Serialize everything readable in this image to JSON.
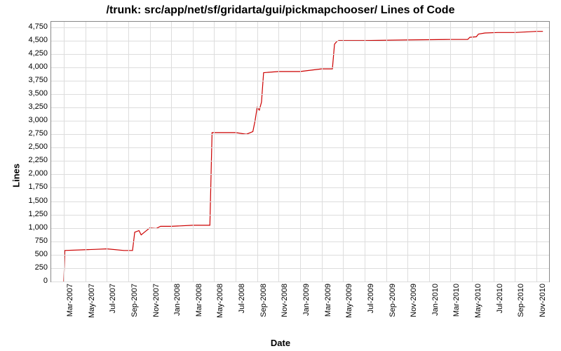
{
  "chart_data": {
    "type": "line",
    "title": "/trunk: src/app/net/sf/gridarta/gui/pickmapchooser/ Lines of Code",
    "xlabel": "Date",
    "ylabel": "Lines",
    "ylim": [
      0,
      4850
    ],
    "yticks": [
      0,
      250,
      500,
      750,
      1000,
      1250,
      1500,
      1750,
      2000,
      2250,
      2500,
      2750,
      3000,
      3250,
      3500,
      3750,
      4000,
      4250,
      4500,
      4750
    ],
    "x_categories": [
      "Mar-2007",
      "May-2007",
      "Jul-2007",
      "Sep-2007",
      "Nov-2007",
      "Jan-2008",
      "Mar-2008",
      "May-2008",
      "Jul-2008",
      "Sep-2008",
      "Nov-2008",
      "Jan-2009",
      "Mar-2009",
      "May-2009",
      "Jul-2009",
      "Sep-2009",
      "Nov-2009",
      "Jan-2010",
      "Mar-2010",
      "May-2010",
      "Jul-2010",
      "Sep-2010",
      "Nov-2010"
    ],
    "series": [
      {
        "name": "Lines of Code",
        "color": "#cc0000",
        "points": [
          {
            "xi": 0.0,
            "y": 0
          },
          {
            "xi": 0.05,
            "y": 580
          },
          {
            "xi": 1.5,
            "y": 600
          },
          {
            "xi": 2.0,
            "y": 610
          },
          {
            "xi": 2.8,
            "y": 580
          },
          {
            "xi": 3.2,
            "y": 580
          },
          {
            "xi": 3.3,
            "y": 920
          },
          {
            "xi": 3.5,
            "y": 950
          },
          {
            "xi": 3.6,
            "y": 870
          },
          {
            "xi": 4.0,
            "y": 1000
          },
          {
            "xi": 4.3,
            "y": 990
          },
          {
            "xi": 4.5,
            "y": 1030
          },
          {
            "xi": 5.0,
            "y": 1030
          },
          {
            "xi": 6.0,
            "y": 1050
          },
          {
            "xi": 6.8,
            "y": 1050
          },
          {
            "xi": 6.9,
            "y": 2780
          },
          {
            "xi": 8.0,
            "y": 2780
          },
          {
            "xi": 8.5,
            "y": 2750
          },
          {
            "xi": 8.8,
            "y": 2800
          },
          {
            "xi": 8.9,
            "y": 3000
          },
          {
            "xi": 9.0,
            "y": 3250
          },
          {
            "xi": 9.1,
            "y": 3200
          },
          {
            "xi": 9.2,
            "y": 3350
          },
          {
            "xi": 9.3,
            "y": 3900
          },
          {
            "xi": 10.0,
            "y": 3920
          },
          {
            "xi": 11.0,
            "y": 3920
          },
          {
            "xi": 12.0,
            "y": 3970
          },
          {
            "xi": 12.5,
            "y": 3970
          },
          {
            "xi": 12.6,
            "y": 4430
          },
          {
            "xi": 12.7,
            "y": 4480
          },
          {
            "xi": 12.8,
            "y": 4500
          },
          {
            "xi": 14.0,
            "y": 4500
          },
          {
            "xi": 16.0,
            "y": 4510
          },
          {
            "xi": 18.0,
            "y": 4520
          },
          {
            "xi": 18.8,
            "y": 4520
          },
          {
            "xi": 18.9,
            "y": 4560
          },
          {
            "xi": 19.2,
            "y": 4570
          },
          {
            "xi": 19.3,
            "y": 4620
          },
          {
            "xi": 19.6,
            "y": 4640
          },
          {
            "xi": 20.2,
            "y": 4650
          },
          {
            "xi": 21.0,
            "y": 4650
          },
          {
            "xi": 22.0,
            "y": 4670
          },
          {
            "xi": 22.3,
            "y": 4670
          }
        ]
      }
    ]
  }
}
